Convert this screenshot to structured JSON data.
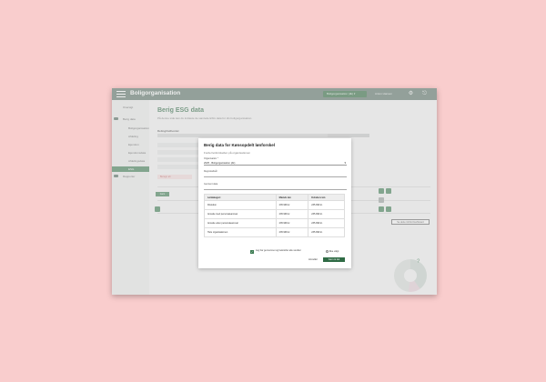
{
  "topbar": {
    "app_title": "Boligorganisation",
    "account": "Boligorganisation (dk) ▾",
    "user": "Anton Hansen",
    "settings_icon": "gear-icon",
    "logout_icon": "logout-icon"
  },
  "sidebar": {
    "items": [
      {
        "label": "Oversigt"
      },
      {
        "label": "Berig data"
      },
      {
        "label": "Boligorganisation"
      },
      {
        "label": "Afdeling"
      },
      {
        "label": "Ejendom"
      },
      {
        "label": "Ejendomsdata"
      },
      {
        "label": "Afdelingsdata"
      },
      {
        "label": "ESG"
      },
      {
        "label": "Rapporter"
      }
    ]
  },
  "main": {
    "title": "Berig ESG data",
    "subtitle": "På denne side kan du indtaste de samlede ESG data for din boligorganisation.",
    "section_label": "Deling/Indhentet",
    "red_note": "Beregn alt",
    "primary_button": "Gem",
    "dashboard_button": "Se dette i ESG Dashboard",
    "help_icon": "question-icon"
  },
  "modal": {
    "title": "Berig data for Kønsopdelt lønforskel",
    "subtitle": "Fordel lønforskellen på organisationen",
    "org_label": "Organisation *",
    "org_value": "2025 - Boligorganisation (dk)",
    "field2_label": "Regnskabsår",
    "field3_label": "Gem/ent data",
    "table": {
      "headers": [
        "Lønkategori",
        "Mænds løn",
        "Kvinders løn"
      ],
      "rows": [
        [
          "Direktion",
          "235.999 kr.",
          "235.999 kr."
        ],
        [
          "Ansatte med personaleansvar",
          "235.999 kr.",
          "235.999 kr."
        ],
        [
          "Ansatte uden personaleansvar",
          "235.999 kr.",
          "235.999 kr."
        ],
        [
          "Hele organisationen",
          "235.999 kr.",
          "235.999 kr."
        ]
      ]
    },
    "checkbox_text": "Jeg har gennemset og bekræftet alle værdier",
    "radio_label": "Ikke valgt",
    "cancel": "Annuller",
    "save": "Gem & luk"
  }
}
